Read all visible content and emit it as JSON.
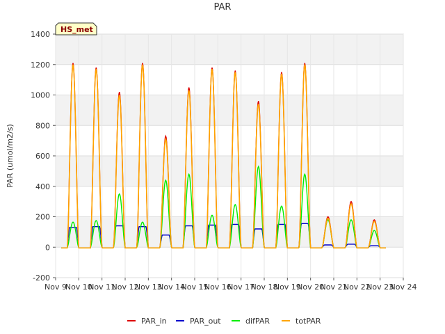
{
  "chart_data": {
    "type": "line",
    "title": "PAR",
    "xlabel": "",
    "ylabel": "PAR (umol/m2/s)",
    "badge": "HS_met",
    "ylim": [
      -200,
      1400
    ],
    "yticks": [
      -200,
      0,
      200,
      400,
      600,
      800,
      1000,
      1200,
      1400
    ],
    "xlim": [
      "2023-11-09",
      "2023-11-24"
    ],
    "xtick_labels": [
      "Nov 9",
      "Nov 10",
      "Nov 11",
      "Nov 12",
      "Nov 13",
      "Nov 14",
      "Nov 15",
      "Nov 16",
      "Nov 17",
      "Nov 18",
      "Nov 19",
      "Nov 20",
      "Nov 21",
      "Nov 22",
      "Nov 23",
      "Nov 24"
    ],
    "grid": true,
    "legend": "bottom",
    "series": [
      {
        "name": "PAR_in",
        "color": "#dd0000",
        "daily_peaks": [
          1210,
          1180,
          1020,
          1210,
          730,
          1050,
          1180,
          1160,
          960,
          1150,
          1210,
          200,
          300,
          180
        ]
      },
      {
        "name": "PAR_out",
        "color": "#0000cc",
        "daily_peaks": [
          130,
          135,
          140,
          135,
          80,
          140,
          145,
          150,
          120,
          150,
          155,
          15,
          20,
          10
        ]
      },
      {
        "name": "difPAR",
        "color": "#00ee00",
        "daily_peaks": [
          165,
          175,
          350,
          165,
          440,
          480,
          210,
          280,
          530,
          270,
          480,
          180,
          180,
          110
        ]
      },
      {
        "name": "totPAR",
        "color": "#ffa500",
        "daily_peaks": [
          1200,
          1170,
          1000,
          1200,
          710,
          1030,
          1170,
          1150,
          940,
          1140,
          1200,
          190,
          285,
          170
        ]
      }
    ]
  }
}
